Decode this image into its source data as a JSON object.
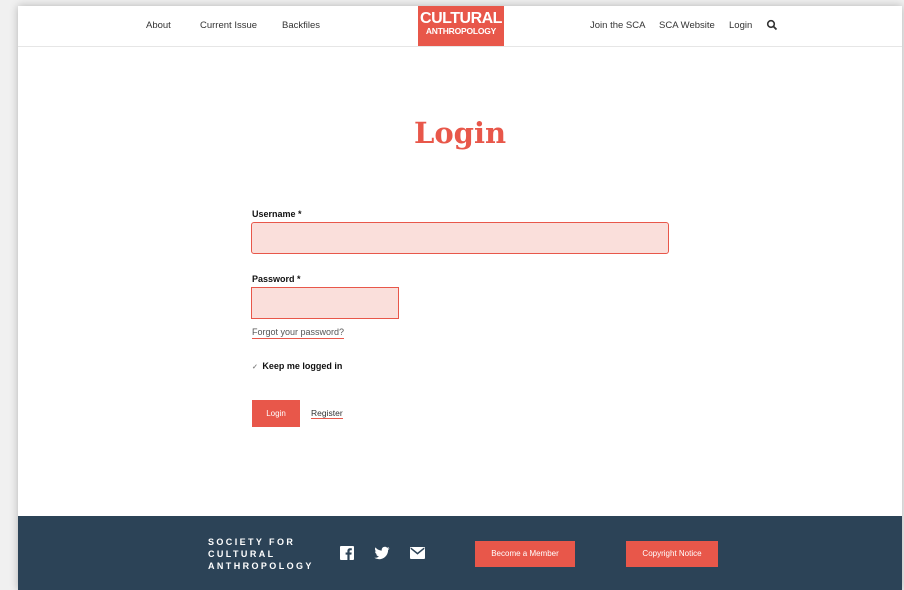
{
  "nav": {
    "about": "About",
    "current_issue": "Current Issue",
    "backfiles": "Backfiles",
    "logo_line1": "CULTURAL",
    "logo_line2": "ANTHROPOLOGY",
    "join": "Join the SCA",
    "sca_website": "SCA Website",
    "login": "Login",
    "search_icon": "search-icon"
  },
  "main": {
    "title": "Login",
    "username_label": "Username *",
    "username_value": "",
    "password_label": "Password *",
    "password_value": "",
    "forgot": "Forgot your password?",
    "keep_logged_in": "Keep me logged in",
    "keep_checked": true,
    "login_button": "Login",
    "register": "Register"
  },
  "footer": {
    "society_line1": "SOCIETY FOR",
    "society_line2": "CULTURAL",
    "society_line3": "ANTHROPOLOGY",
    "social_icons": [
      "facebook-icon",
      "twitter-icon",
      "email-icon"
    ],
    "become_member": "Become a Member",
    "copyright": "Copyright Notice"
  },
  "colors": {
    "accent": "#e8574a",
    "footer_bg": "#2c4357",
    "input_bg": "#fadfdb"
  }
}
